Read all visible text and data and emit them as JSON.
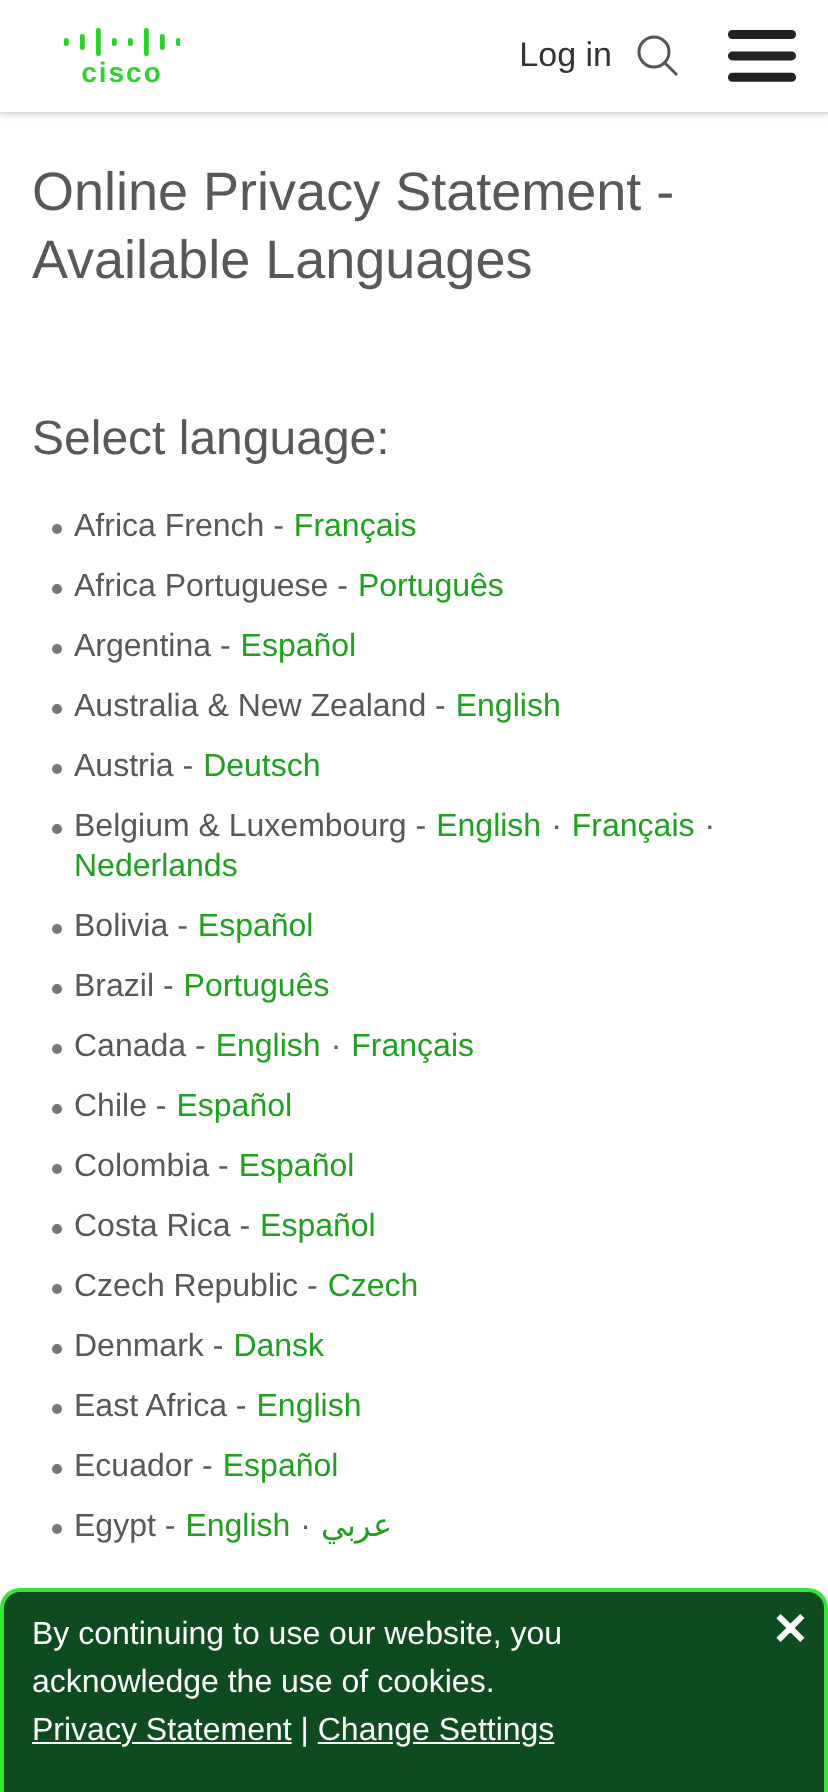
{
  "header": {
    "logo_text": "cisco",
    "login": "Log in"
  },
  "title": "Online Privacy Statement - Available Languages",
  "subtitle": "Select language:",
  "language_separator": "·",
  "countries": [
    {
      "name": "Africa French -",
      "languages": [
        "Français"
      ]
    },
    {
      "name": "Africa Portuguese -",
      "languages": [
        "Português"
      ]
    },
    {
      "name": "Argentina -",
      "languages": [
        "Español"
      ]
    },
    {
      "name": "Australia & New Zealand -",
      "languages": [
        "English"
      ]
    },
    {
      "name": "Austria -",
      "languages": [
        "Deutsch"
      ]
    },
    {
      "name": "Belgium & Luxembourg -",
      "languages": [
        "English",
        "Français",
        "Nederlands"
      ]
    },
    {
      "name": "Bolivia -",
      "languages": [
        "Español"
      ]
    },
    {
      "name": "Brazil -",
      "languages": [
        "Português"
      ]
    },
    {
      "name": "Canada -",
      "languages": [
        "English",
        "Français"
      ]
    },
    {
      "name": "Chile -",
      "languages": [
        "Español"
      ]
    },
    {
      "name": "Colombia -",
      "languages": [
        "Español"
      ]
    },
    {
      "name": "Costa Rica -",
      "languages": [
        "Español"
      ]
    },
    {
      "name": "Czech Republic -",
      "languages": [
        "Czech"
      ]
    },
    {
      "name": "Denmark -",
      "languages": [
        "Dansk"
      ]
    },
    {
      "name": "East Africa -",
      "languages": [
        "English"
      ]
    },
    {
      "name": "Ecuador -",
      "languages": [
        "Español"
      ]
    },
    {
      "name": "Egypt -",
      "languages": [
        "English",
        "عربي"
      ]
    }
  ],
  "cookie_banner": {
    "text": "By continuing to use our website, you acknowledge the use of cookies.",
    "links": [
      "Privacy Statement",
      "Change Settings"
    ],
    "link_separator": "|",
    "close": "✕"
  }
}
